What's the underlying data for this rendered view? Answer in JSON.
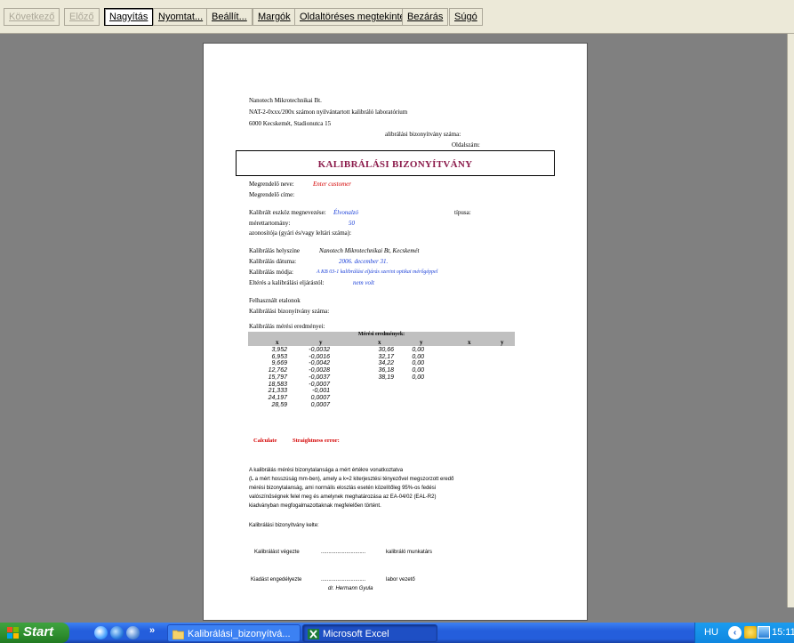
{
  "toolbar": {
    "buttons": [
      "Következő",
      "Előző",
      "Nagyítás",
      "Nyomtat...",
      "Beállít...",
      "Margók",
      "Oldaltöréses megtekintés",
      "Bezárás",
      "Súgó"
    ]
  },
  "doc": {
    "header_lines": [
      "Nanotech Mikrotechnikai Bt.",
      "NAT-2-0xxx/200x számon nyilvántartott kalibráló laboratórium",
      "6000 Kecskemét, Stadionutca 15"
    ],
    "cert_number_label": "alibrálási bizonyítvány száma:",
    "page_number_label": "Oldalszám:",
    "title": "KALIBRÁLÁSI BIZONYÍTVÁNY",
    "customer_name_label": "Megrendelő neve:",
    "customer_name_value": "Enter customer",
    "customer_address_label": "Megrendelő címe:",
    "device_name_label": "Kalibrált eszköz megnevezése:",
    "device_name_value": "Élvonalzó",
    "type_label": "típusa:",
    "range_label": "mérettartomány:",
    "range_value": "50",
    "serial_label": "azonosítója (gyári és/vagy leltári száma):",
    "place_label": "Kalibrálás helyszíne",
    "place_value": "Nanotech Mikrotechnikai Bt, Kecskemét",
    "date_label": "Kalibrálás dátuma:",
    "date_value": "2006. december 31.",
    "method_label": "Kalibrálás módja:",
    "method_value": "A KB 03-1 kalibrálási eljárás szerint optikai mérőgéppel",
    "deviation_label": "Eltérés a kalibrálási eljárástól:",
    "deviation_value": "nem volt",
    "standards_label": "Felhasznált etalonok",
    "standards_cert_label": "Kalibrálási bizonyítvány száma:",
    "results_label": "Kalibrálás mérési eredményei:",
    "results_caption": "Mérési eredmények:",
    "results_col_headers": [
      "x",
      "y",
      "x",
      "y",
      "x",
      "y"
    ],
    "results_col1_x": [
      "3,952",
      "6,953",
      "9,669",
      "12,762",
      "15,797",
      "18,583",
      "21,333",
      "24,197",
      "28,59"
    ],
    "results_col1_y": [
      "-0,0032",
      "-0,0016",
      "-0,0042",
      "-0,0028",
      "-0,0037",
      "-0,0007",
      "-0,001",
      "0,0007",
      "0,0007"
    ],
    "results_col2_x": [
      "30,66",
      "32,17",
      "34,22",
      "36,18",
      "38,19"
    ],
    "results_col2_y": [
      "0,00",
      "0,00",
      "0,00",
      "0,00",
      "0,00"
    ],
    "calculate_label": "Calculate",
    "straightness_label": "Straightness error:",
    "uncertainty_lines": [
      "A kalibrálás mérési bizonytalansága a mért értékre vonatkoztatva",
      "(L a mért hosszúság mm-ben), amely a k=2 kiterjesztési tényezővel megszorzott eredő",
      "mérési bizonytalanság, ami normális eloszlás esetén közelítőleg 95%-os fedési",
      "valószínűségnek felel meg és amelynek meghatározása az EA-04/02 (EAL-R2)",
      "kiadványban megfogalmazottaknak megfelelően történt."
    ],
    "cert_date_label": "Kalibrálási bizonyítvány kelte:",
    "performed_label": "Kalibrálást végezte",
    "dots": "..............................",
    "calibrator_label": "kalibráló munkatárs",
    "issued_label": "Kiadást engedélyezte",
    "signer_name": "dr. Hermann Gyula",
    "lab_head_label": "labor vezető"
  },
  "taskbar": {
    "start_label": "Start",
    "chevron": "»",
    "task1_label": "Kalibrálási_bizonyítvá...",
    "task2_label": "Microsoft Excel",
    "lang": "HU",
    "clock": "15:11"
  },
  "colors": {
    "title": "#8b1a4a",
    "input_blue": "#1a3fd8",
    "input_red": "#d40000",
    "taskbar": "#245edc",
    "start_green": "#2f8e2f"
  }
}
